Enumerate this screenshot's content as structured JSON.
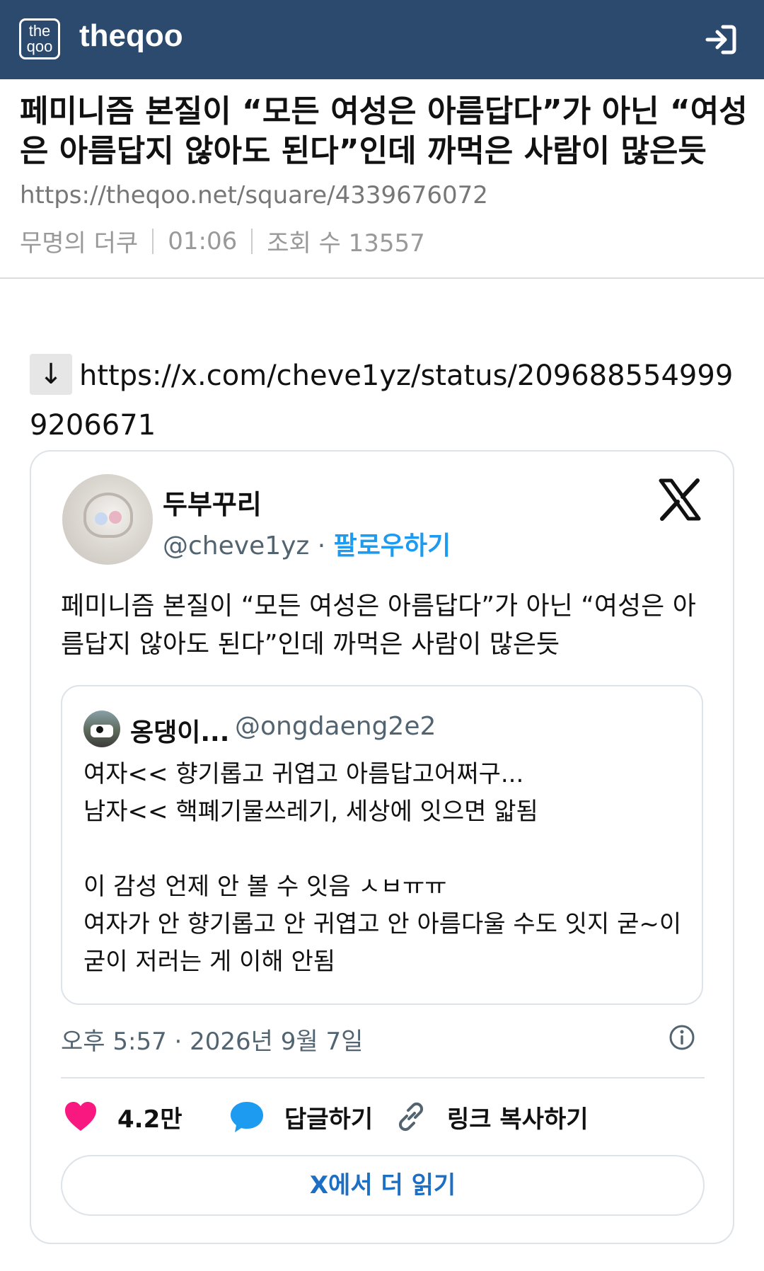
{
  "header": {
    "logo_text": "the qoo",
    "site_name": "theqoo",
    "login_icon": "login-arrow-icon"
  },
  "post": {
    "title": "페미니즘 본질이 “모든 여성은 아름답다”가 아닌 “여성은 아름답지 않아도 된다”인데 까먹은 사람이 많은듯",
    "url": "https://theqoo.net/square/4339676072",
    "author": "무명의 더쿠",
    "time": "01:06",
    "views": "조회 수 13557"
  },
  "link": {
    "arrow": "↓",
    "text": "https://x.com/cheve1yz/status/2096885549999206671"
  },
  "tweet": {
    "author_name": "두부꾸리",
    "handle": "@cheve1yz",
    "handle_sep": " · ",
    "follow_label": "팔로우하기",
    "text": "페미니즘 본질이 “모든 여성은 아름답다”가 아닌 “여성은 아름답지 않아도 된다”인데 까먹은 사람이 많은듯",
    "quote": {
      "name": "옹댕이...",
      "handle": "@ongdaeng2e2",
      "text": "여자<< 향기롭고 귀엽고 아름답고어쩌구...\n남자<< 핵폐기물쓰레기, 세상에 잇으면 앏됨\n\n이 감성 언제 안 볼 수 잇음 ㅅㅂㅠㅠ\n여자가 안 향기롭고 안 귀엽고 안 아름다울 수도 잇지 굳~이 굳이 저러는 게 이해 안됨"
    },
    "timestamp": "오후 5:57 · 2026년 9월 7일",
    "likes": "4.2만",
    "reply_label": "답글하기",
    "copy_link_label": "링크 복사하기",
    "read_more_label": "X에서 더 읽기"
  },
  "colors": {
    "header_bg": "#2c4a6e",
    "like": "#f91880",
    "reply": "#1d9bf0",
    "follow": "#1d9bf0"
  }
}
